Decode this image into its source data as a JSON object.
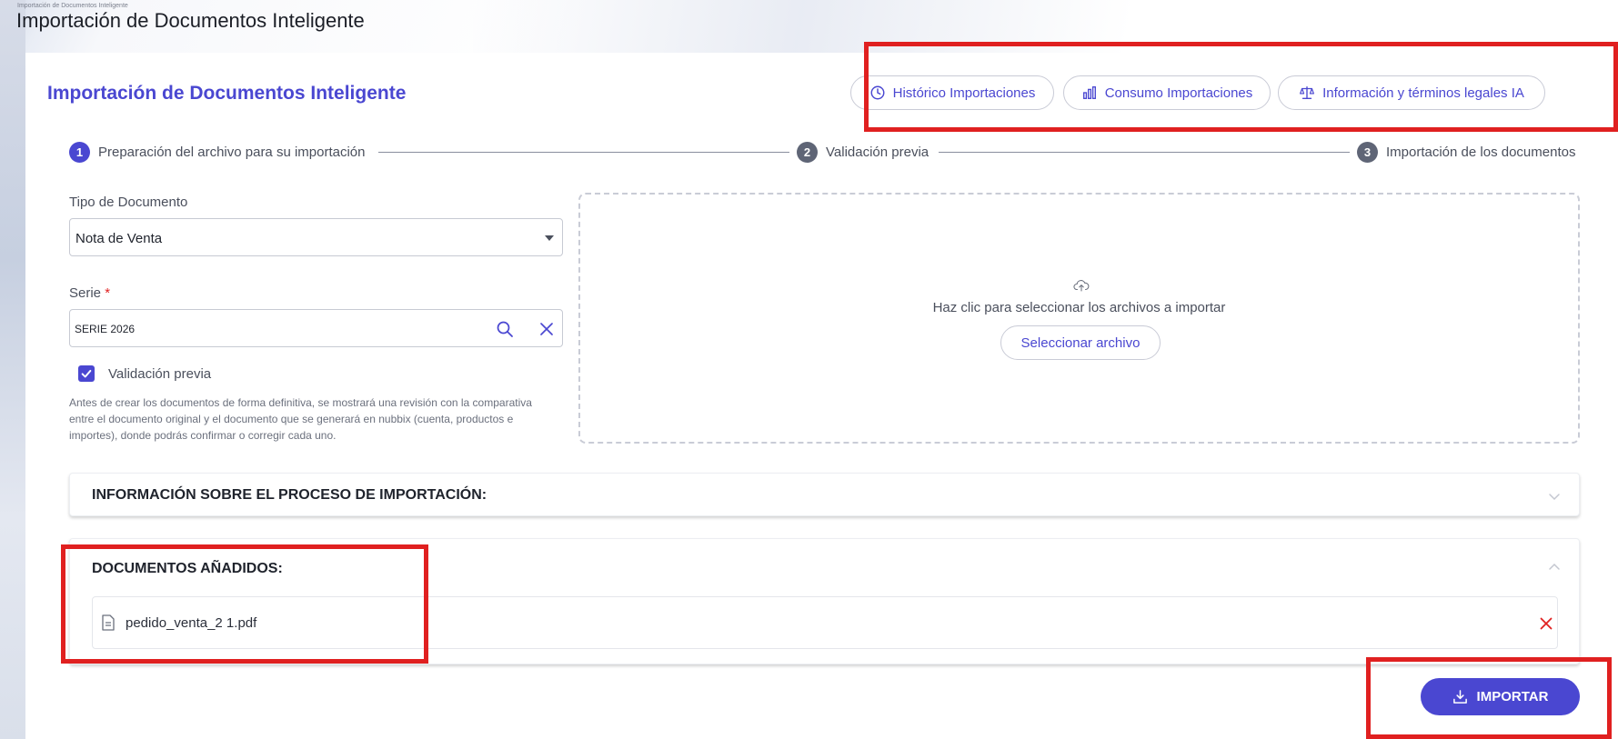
{
  "window": {
    "breadcrumb": "Importación de Documentos Inteligente",
    "title": "Importación de Documentos Inteligente"
  },
  "page": {
    "title": "Importación de Documentos Inteligente"
  },
  "header_actions": [
    {
      "label": "Histórico Importaciones",
      "icon": "clock-icon"
    },
    {
      "label": "Consumo Importaciones",
      "icon": "bar-chart-icon"
    },
    {
      "label": "Información y términos legales IA",
      "icon": "scale-icon"
    }
  ],
  "stepper": [
    {
      "number": "1",
      "label": "Preparación del archivo para su importación",
      "active": true
    },
    {
      "number": "2",
      "label": "Validación previa",
      "active": false
    },
    {
      "number": "3",
      "label": "Importación de los documentos",
      "active": false
    }
  ],
  "form": {
    "document_type_label": "Tipo de Documento",
    "document_type_value": "Nota de Venta",
    "serie_label": "Serie",
    "serie_required_mark": "*",
    "serie_value": "SERIE 2026",
    "validation_label": "Validación previa",
    "validation_checked": true,
    "validation_help": "Antes de crear los documentos de forma definitiva, se mostrará una revisión con la comparativa entre el documento original y el documento que se generará en nubbix (cuenta, productos e importes), donde podrás confirmar o corregir cada uno."
  },
  "dropzone": {
    "text": "Haz clic para seleccionar los archivos a importar",
    "button_label": "Seleccionar archivo"
  },
  "info_panel": {
    "title": "INFORMACIÓN SOBRE EL PROCESO DE IMPORTACIÓN:"
  },
  "documents_panel": {
    "title": "DOCUMENTOS AÑADIDOS:",
    "files": [
      {
        "name": "pedido_venta_2 1.pdf"
      }
    ]
  },
  "import_button": {
    "label": "IMPORTAR"
  },
  "colors": {
    "accent": "#4a47d1",
    "annotation_red": "#e02020",
    "step_inactive": "#5f6576"
  }
}
